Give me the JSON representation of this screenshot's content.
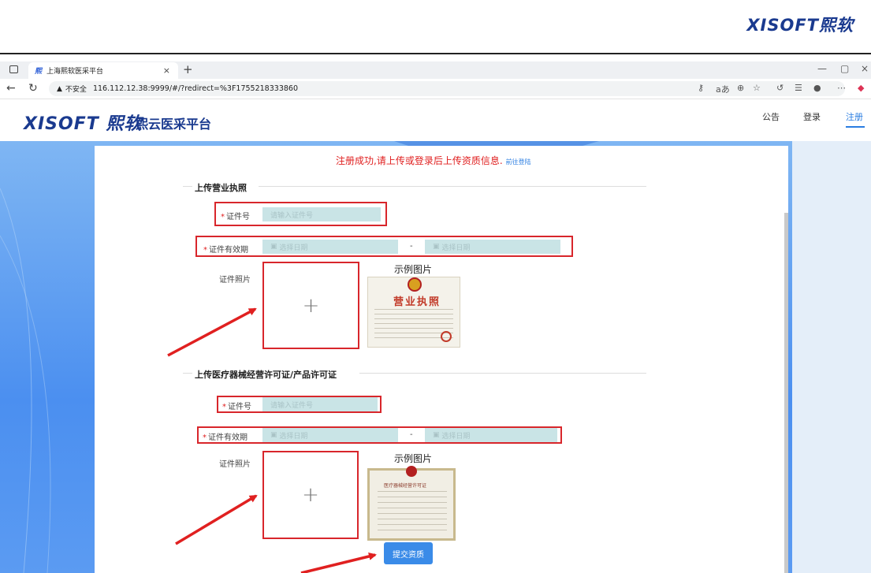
{
  "corp_logo": "XISOFT熙软",
  "browser": {
    "tab_title": "上海熙软医采平台",
    "tab_icon": "熙",
    "tab_close": "×",
    "new_tab": "+",
    "insecure_label": "不安全",
    "url": "116.112.12.38:9999/#/?redirect=%3F1755218333860",
    "window_controls": [
      "—",
      "▢",
      "×"
    ]
  },
  "site": {
    "logo": "XISOFT 熙软",
    "name": "熙云医采平台",
    "nav": [
      "公告",
      "登录",
      "注册"
    ]
  },
  "notice": {
    "text": "注册成功,请上传或登录后上传资质信息.",
    "link": "前往登陆"
  },
  "sections": [
    {
      "title": "上传营业执照",
      "cert_no_label": "证件号",
      "cert_no_placeholder": "请输入证件号",
      "validity_label": "证件有效期",
      "date_start_placeholder": "选择日期",
      "date_end_placeholder": "选择日期",
      "date_sep": "-",
      "photo_label": "证件照片",
      "upload_plus": "+",
      "sample_title": "示例图片",
      "sample_text": "营业执照"
    },
    {
      "title": "上传医疗器械经营许可证/产品许可证",
      "cert_no_label": "证件号",
      "cert_no_placeholder": "请输入证件号",
      "validity_label": "证件有效期",
      "date_start_placeholder": "选择日期",
      "date_end_placeholder": "选择日期",
      "date_sep": "-",
      "photo_label": "证件照片",
      "upload_plus": "+",
      "sample_title": "示例图片",
      "sample_text": "医疗器械经营许可证"
    }
  ],
  "submit_label": "提交资质",
  "colors": {
    "accent": "#3a8be8",
    "error": "#e02020",
    "annotation": "#d8262b",
    "brand": "#1a3a8f"
  }
}
